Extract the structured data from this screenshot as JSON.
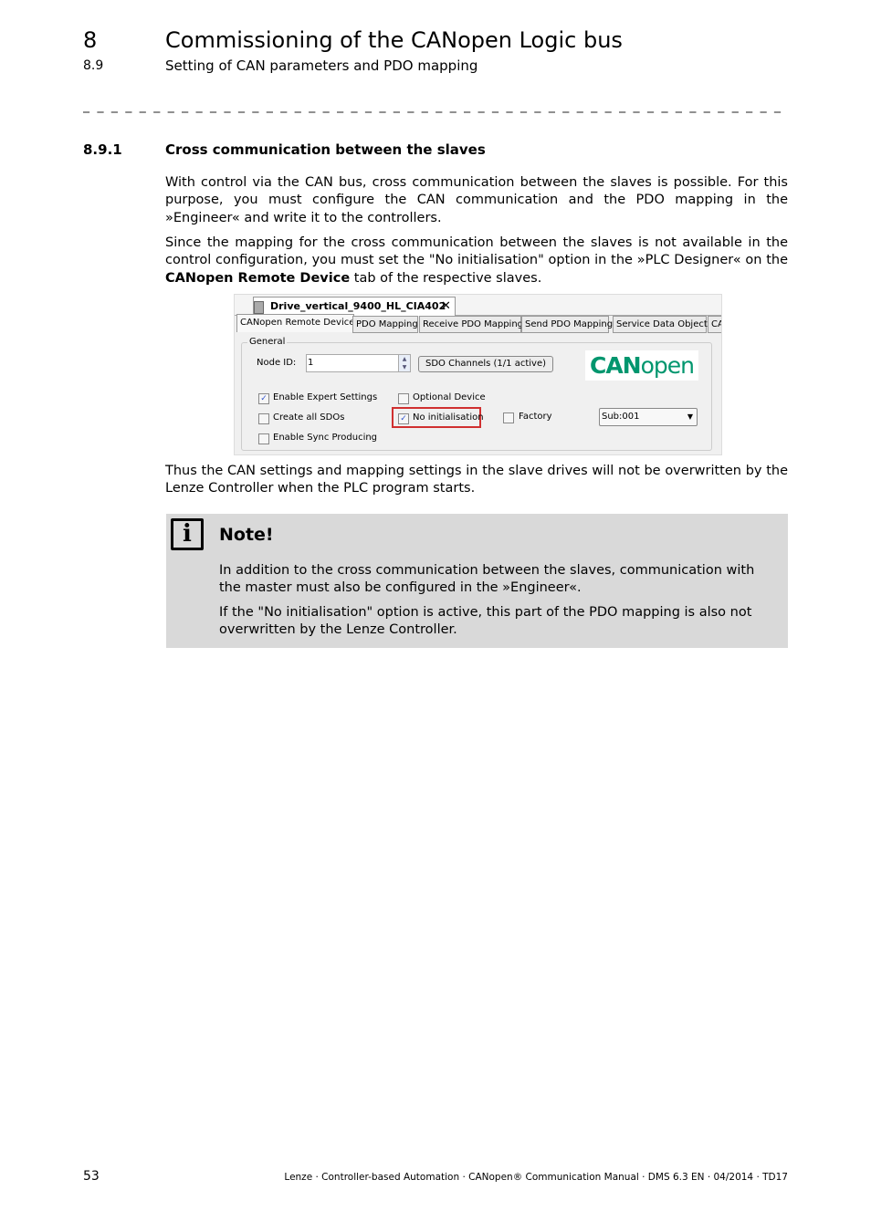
{
  "header": {
    "chapter_number": "8",
    "chapter_title": "Commissioning of the CANopen Logic bus",
    "section_number": "8.9",
    "section_title": "Setting of CAN parameters and PDO mapping",
    "separator": "_ _ _ _ _ _ _ _ _ _ _ _ _ _ _ _ _ _ _ _ _ _ _ _ _ _ _ _ _ _ _ _ _ _ _ _ _ _ _ _ _ _ _ _ _ _ _ _ _ _ _ _ _ _ _ _ _ _ _ _ _ _ _ _"
  },
  "subsection": {
    "number": "8.9.1",
    "title": "Cross communication between the slaves"
  },
  "paragraphs": {
    "p1": "With control via the CAN bus, cross communication between the slaves is possible. For this purpose, you must configure the CAN communication and the PDO mapping in the »Engineer« and write it to the controllers.",
    "p2_a": "Since the mapping for the cross communication between the slaves is not available in the control configuration, you must set the \"No initialisation\" option in the »PLC Designer« on the ",
    "p2_bold": "CANopen Remote Device",
    "p2_b": " tab of the respective slaves.",
    "p3": "Thus the CAN settings and mapping settings in the slave drives will not be overwritten by the Lenze Controller when the PLC program starts."
  },
  "screenshot": {
    "doc_tab": "Drive_vertical_9400_HL_CIA402",
    "tabs": [
      "CANopen Remote Device",
      "PDO Mapping",
      "Receive PDO Mapping",
      "Send PDO Mapping",
      "Service Data Object",
      "CA"
    ],
    "group_label": "General",
    "node_id_label": "Node ID:",
    "node_id_value": "1",
    "sdo_button": "SDO Channels (1/1 active)",
    "logo": "CANopen",
    "checkboxes": [
      {
        "label": "Enable Expert Settings",
        "checked": true
      },
      {
        "label": "Create all SDOs",
        "checked": false
      },
      {
        "label": "Enable Sync Producing",
        "checked": false
      },
      {
        "label": "Optional Device",
        "checked": false
      },
      {
        "label": "No initialisation",
        "checked": true
      },
      {
        "label": "Factory",
        "checked": false
      }
    ],
    "sub_select": "Sub:001",
    "highlight_color": "#d03030",
    "logo_color": "#00966e"
  },
  "note": {
    "title": "Note!",
    "icon": "info-icon",
    "p1": "In addition to the cross communication between the slaves, communication with the master must also be configured in the »Engineer«.",
    "p2": "If the \"No initialisation\" option is active, this part of the PDO mapping is also not overwritten by the Lenze Controller."
  },
  "footer": {
    "page_number": "53",
    "text": "Lenze · Controller-based Automation · CANopen® Communication Manual · DMS 6.3 EN · 04/2014 · TD17"
  }
}
